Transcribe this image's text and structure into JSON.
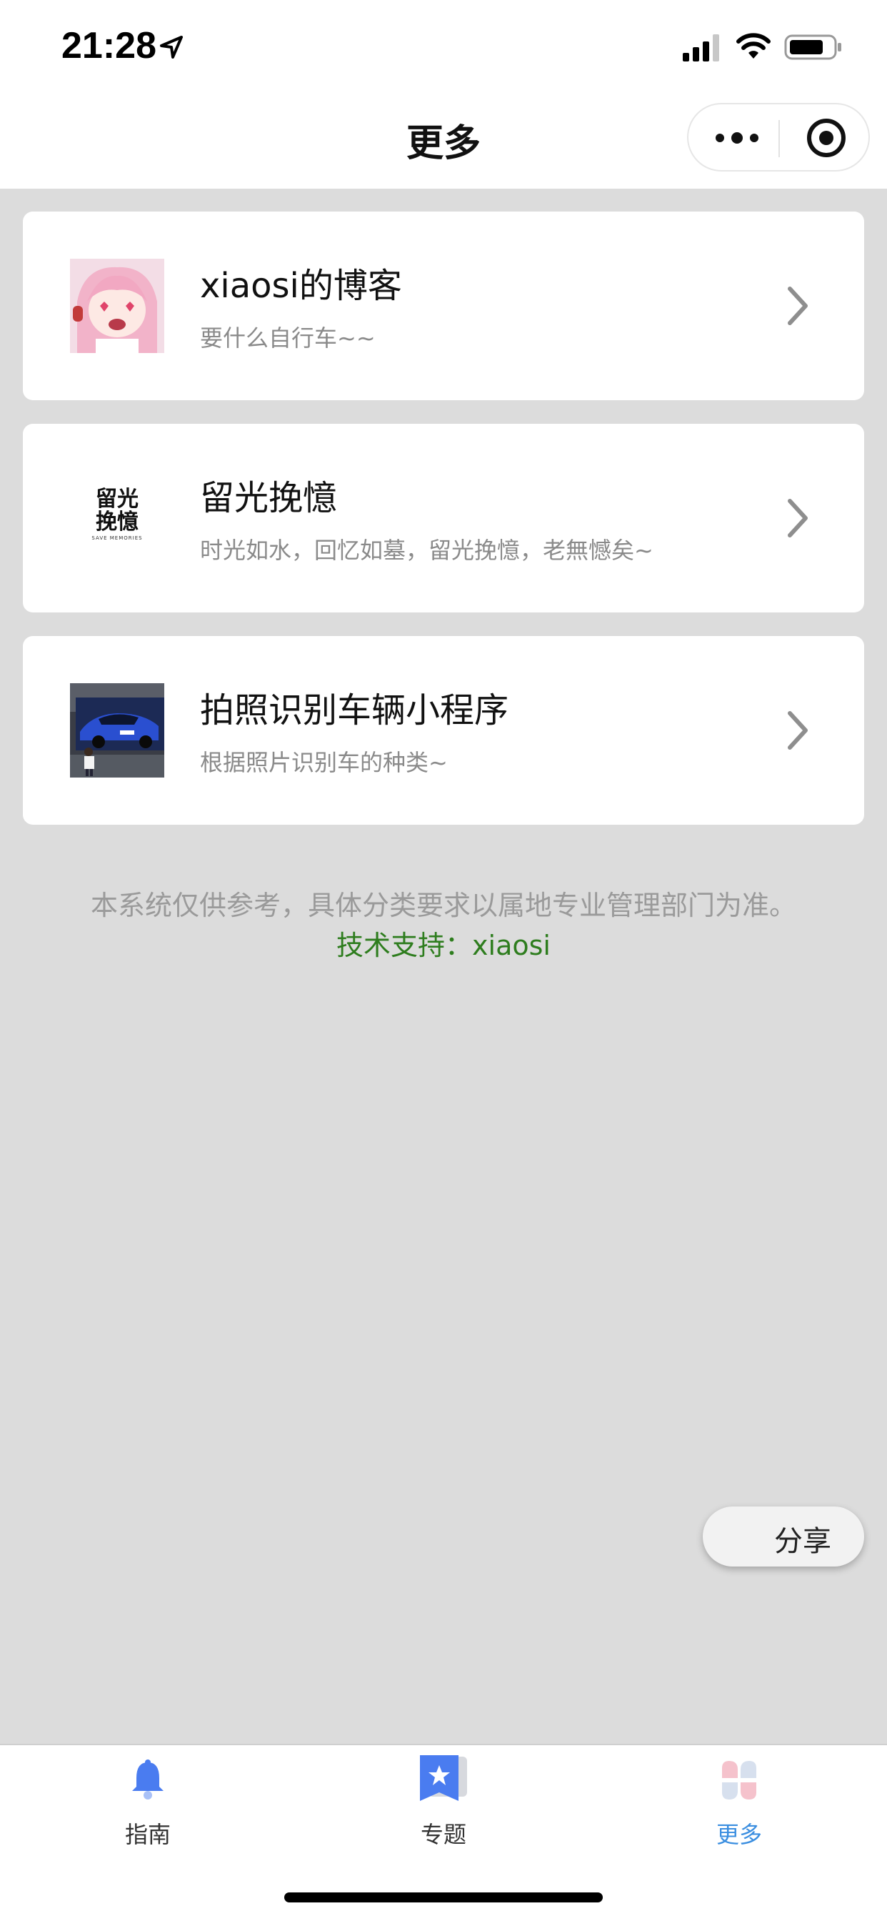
{
  "status_bar": {
    "time": "21:28"
  },
  "nav": {
    "title": "更多"
  },
  "cards": [
    {
      "title": "xiaosi的博客",
      "subtitle": "要什么自行车~~",
      "thumb": "anime-girl-avatar"
    },
    {
      "title": "留光挽憶",
      "subtitle": "时光如水，回忆如墓，留光挽憶，老無憾矣~",
      "thumb": "logo-text",
      "logo": {
        "line1": "留光",
        "line2": "挽憶",
        "tagline": "SAVE MEMORIES"
      }
    },
    {
      "title": "拍照识别车辆小程序",
      "subtitle": "根据照片识别车的种类~",
      "thumb": "blue-car-photo"
    }
  ],
  "footer": {
    "notice": "本系统仅供参考，具体分类要求以属地专业管理部门为准。",
    "support": "技术支持：xiaosi"
  },
  "share": {
    "label": "分享"
  },
  "tabbar": {
    "items": [
      {
        "label": "指南",
        "icon": "bell-icon",
        "active": false
      },
      {
        "label": "专题",
        "icon": "bookmark-star-icon",
        "active": false
      },
      {
        "label": "更多",
        "icon": "petals-icon",
        "active": true
      }
    ]
  },
  "colors": {
    "page_bg": "#dcdcdc",
    "card_bg": "#ffffff",
    "support_text": "#2e7d1e",
    "tab_active": "#3a8ee0",
    "icon_blue": "#4a7cf0"
  }
}
